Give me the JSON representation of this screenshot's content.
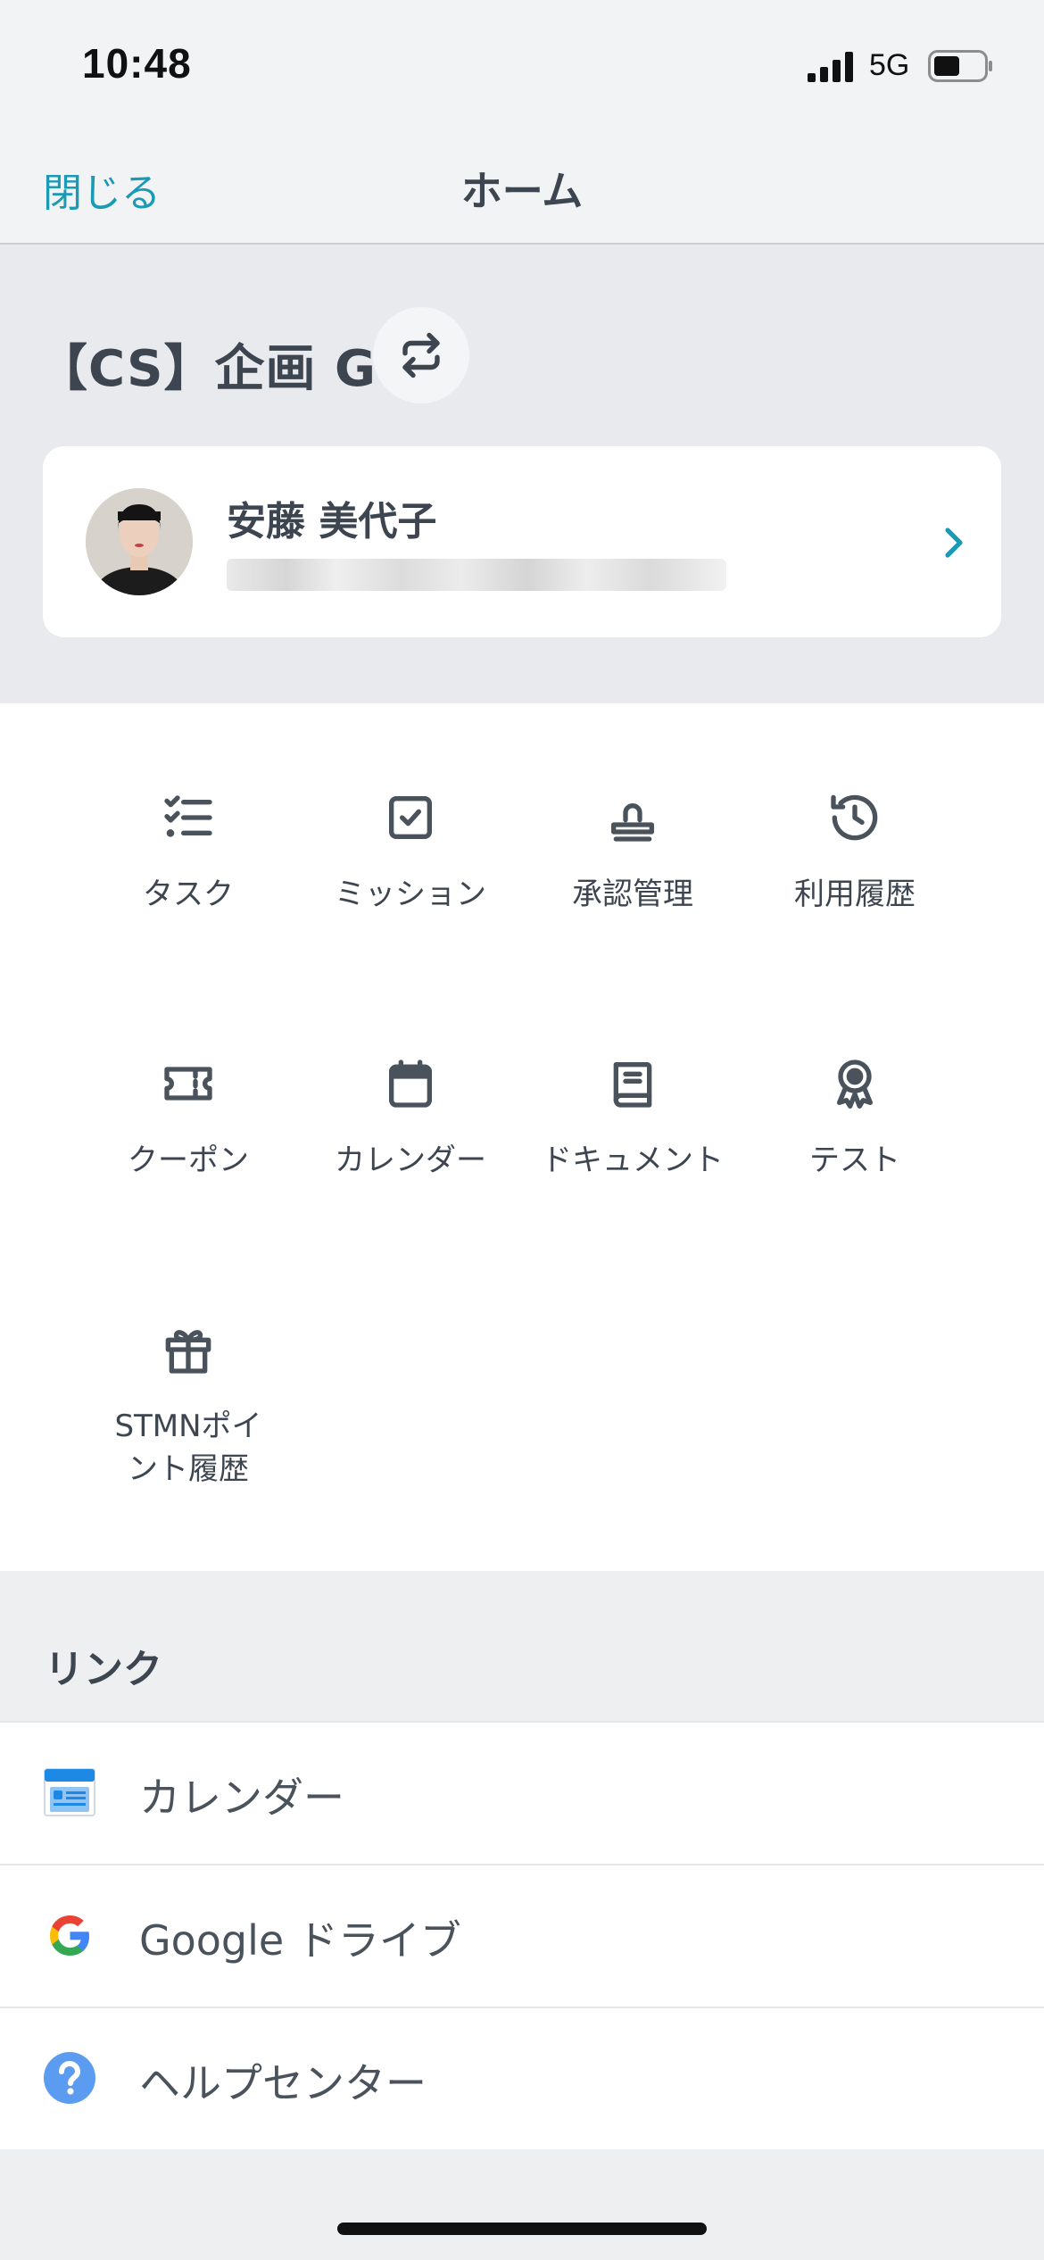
{
  "status_bar": {
    "time": "10:48",
    "network": "5G"
  },
  "nav": {
    "close_label": "閉じる",
    "title": "ホーム"
  },
  "header": {
    "group_name": "【CS】企画 G",
    "switch_icon": "repeat-arrows-icon",
    "profile": {
      "name": "安藤 美代子",
      "email": ""
    }
  },
  "menu": {
    "items": [
      {
        "label": "タスク",
        "icon": "checklist-icon"
      },
      {
        "label": "ミッション",
        "icon": "checkbox-icon"
      },
      {
        "label": "承認管理",
        "icon": "stamp-icon"
      },
      {
        "label": "利用履歴",
        "icon": "history-icon"
      },
      {
        "label": "クーポン",
        "icon": "ticket-icon"
      },
      {
        "label": "カレンダー",
        "icon": "calendar-icon"
      },
      {
        "label": "ドキュメント",
        "icon": "book-icon"
      },
      {
        "label": "テスト",
        "icon": "award-icon"
      },
      {
        "label": "STMNポイ\nント履歴",
        "icon": "gift-icon"
      }
    ]
  },
  "links": {
    "title": "リンク",
    "items": [
      {
        "label": "カレンダー",
        "icon": "calendar-app-icon"
      },
      {
        "label": "Google ドライブ",
        "icon": "google-icon"
      },
      {
        "label": "ヘルプセンター",
        "icon": "help-icon"
      }
    ]
  },
  "colors": {
    "accent": "#1a9ab4",
    "text": "#3d4550",
    "icon": "#4a525c",
    "background": "#eeeff1"
  }
}
